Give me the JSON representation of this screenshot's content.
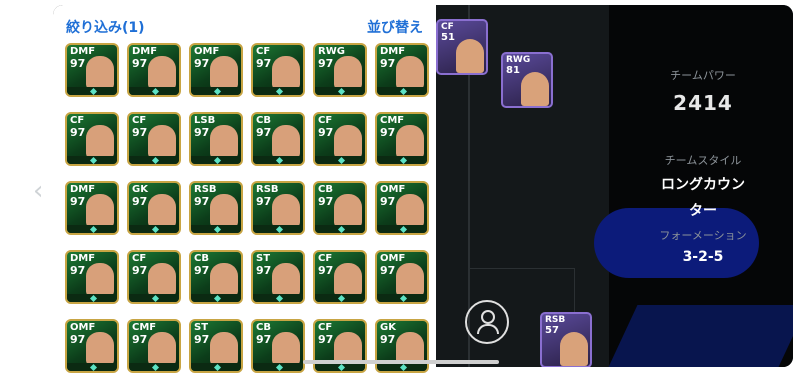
{
  "filter_header": {
    "filter_label": "絞り込み(1)",
    "sort_label": "並び替え"
  },
  "back_chevron": "‹",
  "cards": [
    {
      "pos": "DMF",
      "rating": "97"
    },
    {
      "pos": "DMF",
      "rating": "97"
    },
    {
      "pos": "OMF",
      "rating": "97"
    },
    {
      "pos": "CF",
      "rating": "97"
    },
    {
      "pos": "RWG",
      "rating": "97"
    },
    {
      "pos": "DMF",
      "rating": "97"
    },
    {
      "pos": "CF",
      "rating": "97"
    },
    {
      "pos": "CF",
      "rating": "97"
    },
    {
      "pos": "LSB",
      "rating": "97"
    },
    {
      "pos": "CB",
      "rating": "97"
    },
    {
      "pos": "CF",
      "rating": "97"
    },
    {
      "pos": "CMF",
      "rating": "97"
    },
    {
      "pos": "DMF",
      "rating": "97"
    },
    {
      "pos": "GK",
      "rating": "97"
    },
    {
      "pos": "RSB",
      "rating": "97"
    },
    {
      "pos": "RSB",
      "rating": "97"
    },
    {
      "pos": "CB",
      "rating": "97"
    },
    {
      "pos": "OMF",
      "rating": "97"
    },
    {
      "pos": "DMF",
      "rating": "97"
    },
    {
      "pos": "CF",
      "rating": "97"
    },
    {
      "pos": "CB",
      "rating": "97"
    },
    {
      "pos": "ST",
      "rating": "97"
    },
    {
      "pos": "CF",
      "rating": "97"
    },
    {
      "pos": "OMF",
      "rating": "97"
    },
    {
      "pos": "OMF",
      "rating": "97"
    },
    {
      "pos": "CMF",
      "rating": "97"
    },
    {
      "pos": "ST",
      "rating": "97"
    },
    {
      "pos": "CB",
      "rating": "97"
    },
    {
      "pos": "CF",
      "rating": "97"
    },
    {
      "pos": "GK",
      "rating": "97"
    }
  ],
  "field_players": [
    {
      "pos": "CF",
      "rating": "51"
    },
    {
      "pos": "RWG",
      "rating": "81"
    },
    {
      "pos": "RSB",
      "rating": "57"
    }
  ],
  "team_stats": {
    "power_label": "チームパワー",
    "power_value": "2414",
    "style_label": "チームスタイル",
    "style_value_line1": "ロングカウン",
    "style_value_line2": "ター",
    "formation_label": "フォーメーション",
    "formation_value": "3-2-5"
  }
}
